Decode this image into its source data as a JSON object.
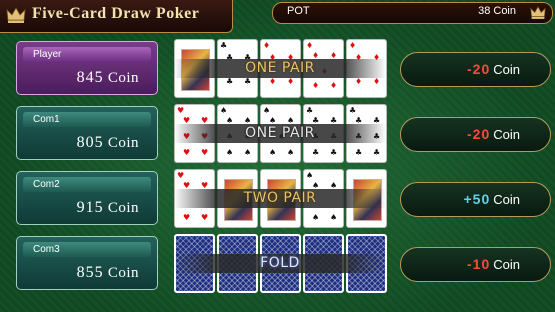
{
  "header": {
    "title": "Five-Card Draw Poker",
    "pot_label": "POT",
    "pot_value": "38 Coin"
  },
  "players": [
    {
      "name": "Player",
      "coins": "845",
      "unit": "Coin",
      "active": true
    },
    {
      "name": "Com1",
      "coins": "805",
      "unit": "Coin",
      "active": false
    },
    {
      "name": "Com2",
      "coins": "915",
      "unit": "Coin",
      "active": false
    },
    {
      "name": "Com3",
      "coins": "855",
      "unit": "Coin",
      "active": false
    }
  ],
  "hands": [
    {
      "label": "ONE PAIR",
      "style": "gold"
    },
    {
      "label": "ONE PAIR",
      "style": "silver"
    },
    {
      "label": "TWO PAIR",
      "style": "gold"
    },
    {
      "label": "FOLD",
      "style": "blue"
    }
  ],
  "results": [
    {
      "value": "-20",
      "unit": "Coin",
      "color": "#ff4a3a"
    },
    {
      "value": "-20",
      "unit": "Coin",
      "color": "#ff4a3a"
    },
    {
      "value": "+50",
      "unit": "Coin",
      "color": "#5fd3ee"
    },
    {
      "value": "-10",
      "unit": "Coin",
      "color": "#ff4a3a"
    }
  ],
  "icons": {
    "title_icon": "crown-icon",
    "pot_icon": "crown-icon"
  },
  "colors": {
    "felt": "#0f4a22",
    "active_panel": "#7a3c8a",
    "panel": "#1d5650",
    "gold": "#b78d45"
  }
}
